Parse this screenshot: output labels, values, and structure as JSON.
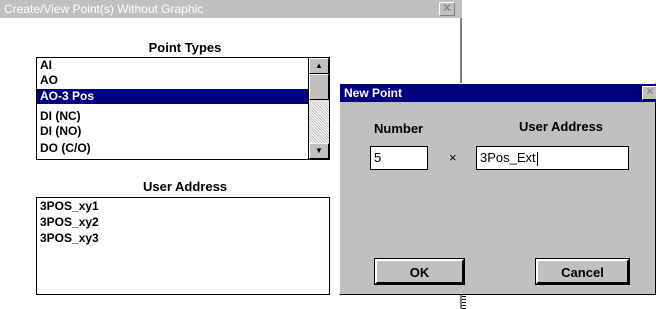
{
  "main_window": {
    "title": "Create/View Point(s) Without Graphic",
    "close_glyph": "✕",
    "point_types_heading": "Point Types",
    "point_types": [
      {
        "label": "AI",
        "selected": false
      },
      {
        "label": "AO",
        "selected": false
      },
      {
        "label": "AO-3 Pos",
        "selected": true
      },
      {
        "label": "DI (NC)",
        "selected": false
      },
      {
        "label": "DI (NO)",
        "selected": false
      },
      {
        "label": "DO (C/O)",
        "selected": false
      }
    ],
    "user_address_heading": "User Address",
    "user_addresses": [
      "3POS_xy1",
      "3POS_xy2",
      "3POS_xy3"
    ]
  },
  "dialog": {
    "title": "New Point",
    "close_glyph": "✕",
    "number_label": "Number",
    "user_address_label": "User Address",
    "number_value": "5",
    "times_glyph": "×",
    "address_value": "3Pos_Ext",
    "ok_label": "OK",
    "cancel_label": "Cancel"
  },
  "icons": {
    "scroll_up": "up-arrow-icon",
    "scroll_down": "down-arrow-icon"
  },
  "colors": {
    "selection": "#000080",
    "title_active": "#000080",
    "title_inactive": "#c0c0c0",
    "face": "#c0c0c0"
  }
}
